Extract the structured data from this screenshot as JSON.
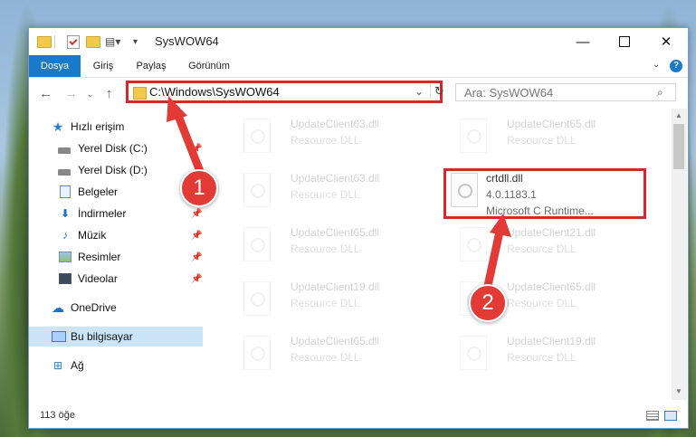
{
  "window": {
    "title": "SysWOW64",
    "controls": {
      "minimize": "—",
      "close": "✕"
    }
  },
  "ribbon": {
    "tabs": [
      {
        "label": "Dosya"
      },
      {
        "label": "Giriş"
      },
      {
        "label": "Paylaş"
      },
      {
        "label": "Görünüm"
      }
    ],
    "help": "?"
  },
  "nav": {
    "back": "←",
    "forward": "→",
    "recent": "⌄",
    "up": "↑",
    "address": "C:\\Windows\\SysWOW64",
    "search_placeholder": "Ara: SysWOW64"
  },
  "sidebar": {
    "items": [
      {
        "label": "Hızlı erişim"
      },
      {
        "label": "Yerel Disk (C:)"
      },
      {
        "label": "Yerel Disk (D:)"
      },
      {
        "label": "Belgeler"
      },
      {
        "label": "İndirmeler"
      },
      {
        "label": "Müzik"
      },
      {
        "label": "Resimler"
      },
      {
        "label": "Videolar"
      },
      {
        "label": "OneDrive"
      },
      {
        "label": "Bu bilgisayar"
      },
      {
        "label": "Ağ"
      }
    ]
  },
  "files": {
    "left": [
      {
        "name": "UpdateClient63.dll",
        "desc": "Resource DLL"
      },
      {
        "name": "UpdateClient63.dll",
        "desc": "Resource DLL"
      },
      {
        "name": "UpdateClient65.dll",
        "desc": "Resource DLL"
      },
      {
        "name": "UpdateClient19.dll",
        "desc": "Resource DLL"
      },
      {
        "name": "UpdateClient65.dll",
        "desc": "Resource DLL"
      }
    ],
    "right": [
      {
        "name": "UpdateClient65.dll",
        "desc": "Resource DLL"
      },
      {
        "name": "UpdateClient21.dll",
        "desc": "Resource DLL"
      },
      {
        "name": "UpdateClient65.dll",
        "desc": "Resource DLL"
      },
      {
        "name": "UpdateClient19.dll",
        "desc": "Resource DLL"
      }
    ],
    "highlighted": {
      "name": "crtdll.dll",
      "version": "4.0.1183.1",
      "desc": "Microsoft C Runtime..."
    }
  },
  "status": {
    "count": "113 öğe"
  },
  "annotations": {
    "step1": "1",
    "step2": "2"
  },
  "colors": {
    "accent": "#1979ca",
    "annotation_red": "#d9262a"
  }
}
